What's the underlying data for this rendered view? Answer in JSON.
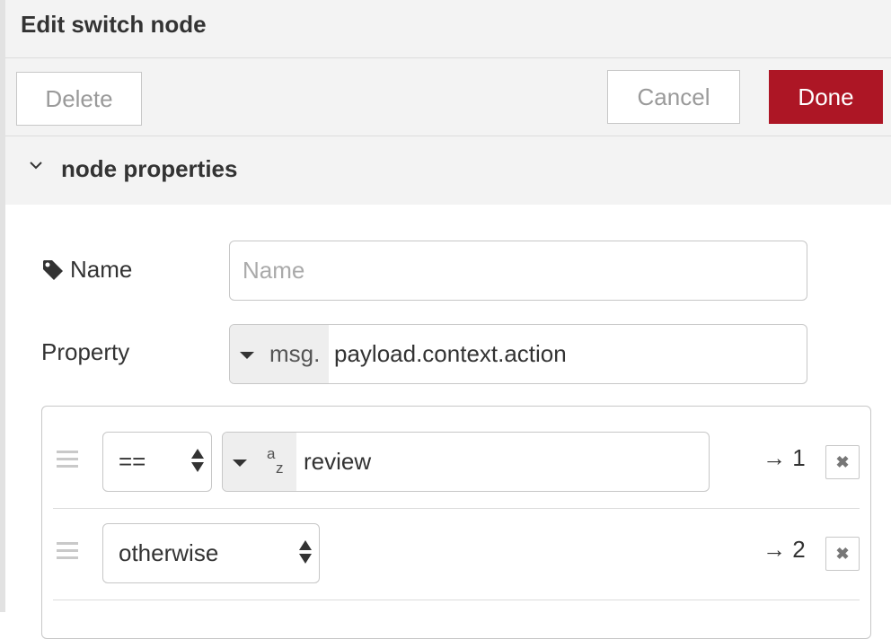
{
  "tray": {
    "title": "Edit switch node",
    "delete_label": "Delete",
    "cancel_label": "Cancel",
    "done_label": "Done",
    "done_color": "#ad1625"
  },
  "section": {
    "title": "node properties",
    "icon": "chevron-down-icon"
  },
  "form": {
    "name": {
      "label": "Name",
      "icon": "tag-icon",
      "placeholder": "Name",
      "value": ""
    },
    "property": {
      "label": "Property",
      "type_prefix": "msg.",
      "value": "payload.context.action"
    }
  },
  "rules": [
    {
      "operator": "==",
      "value_type_icon": "az-string-icon",
      "value": "review",
      "output": "→ 1"
    },
    {
      "operator": "otherwise",
      "output": "→ 2"
    }
  ]
}
